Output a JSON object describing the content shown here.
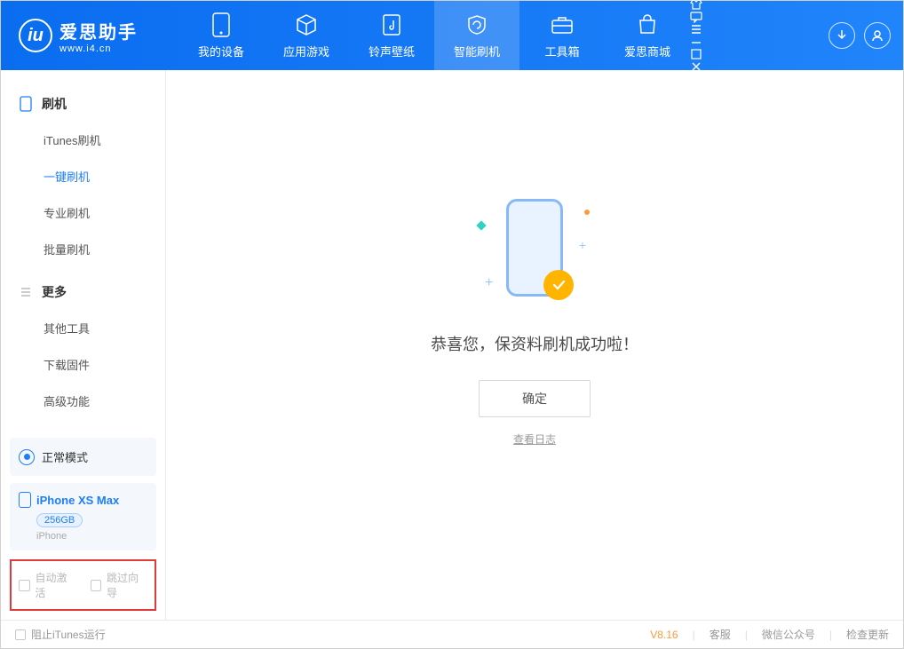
{
  "app": {
    "name": "爱思助手",
    "site": "www.i4.cn"
  },
  "nav": {
    "my_device": "我的设备",
    "apps": "应用游戏",
    "ringtones": "铃声壁纸",
    "flash": "智能刷机",
    "toolbox": "工具箱",
    "store": "爱思商城"
  },
  "sidebar": {
    "group_flash": "刷机",
    "items_flash": [
      "iTunes刷机",
      "一键刷机",
      "专业刷机",
      "批量刷机"
    ],
    "group_more": "更多",
    "items_more": [
      "其他工具",
      "下载固件",
      "高级功能"
    ]
  },
  "mode_card": {
    "label": "正常模式"
  },
  "device": {
    "name": "iPhone XS Max",
    "capacity": "256GB",
    "type": "iPhone"
  },
  "options": {
    "auto_activate": "自动激活",
    "skip_guide": "跳过向导"
  },
  "main": {
    "success_msg": "恭喜您，保资料刷机成功啦！",
    "ok": "确定",
    "view_log": "查看日志"
  },
  "footer": {
    "block_itunes": "阻止iTunes运行",
    "version": "V8.16",
    "support": "客服",
    "wechat": "微信公众号",
    "update": "检查更新"
  }
}
